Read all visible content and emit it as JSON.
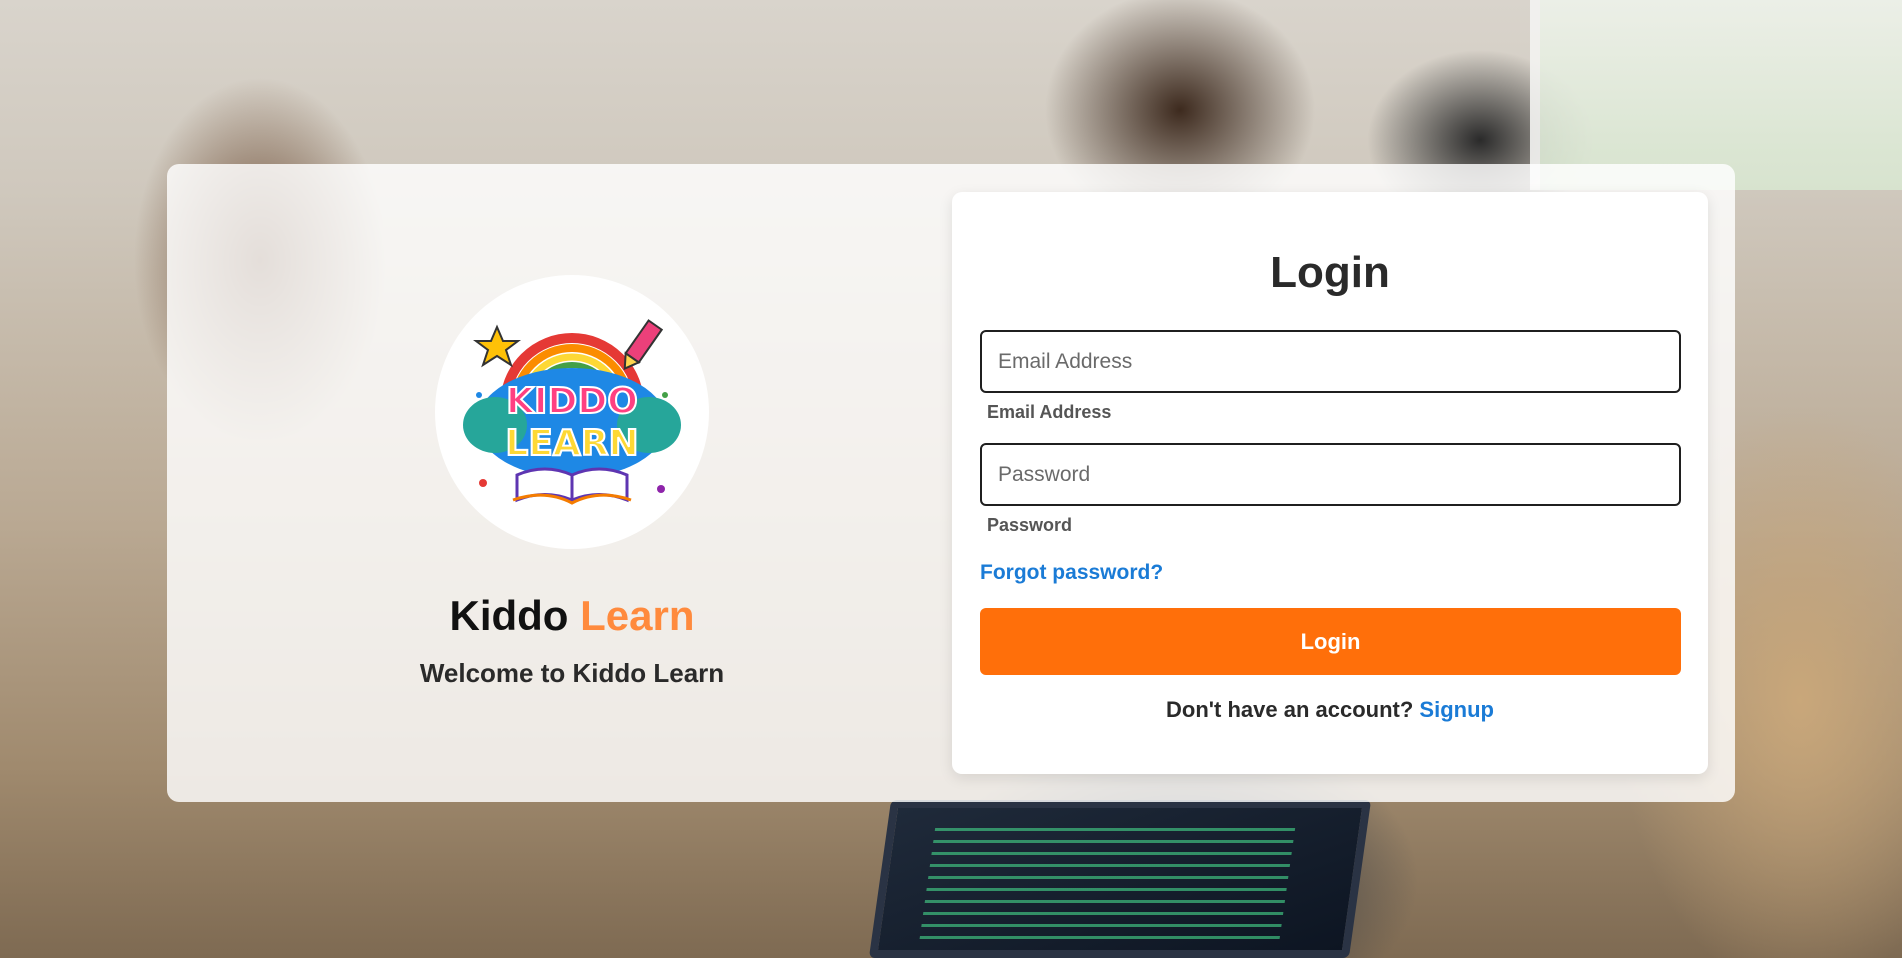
{
  "brand": {
    "logo_text_line1": "KIDDO",
    "logo_text_line2": "LEARN",
    "title_part1": "Kiddo",
    "title_part2": "Learn",
    "subtitle": "Welcome to Kiddo Learn",
    "accent_color": "#ff8a3d"
  },
  "login": {
    "title": "Login",
    "email_placeholder": "Email Address",
    "email_label": "Email Address",
    "email_value": "",
    "password_placeholder": "Password",
    "password_label": "Password",
    "password_value": "",
    "forgot_password": "Forgot password?",
    "submit_label": "Login",
    "signup_prompt": "Don't have an account?",
    "signup_link": "Signup",
    "button_color": "#ff6f0a",
    "link_color": "#1a7bd6"
  },
  "icons": {
    "logo": "kiddo-learn-logo",
    "star": "star-icon",
    "pencil": "pencil-icon",
    "book": "open-book-icon"
  }
}
